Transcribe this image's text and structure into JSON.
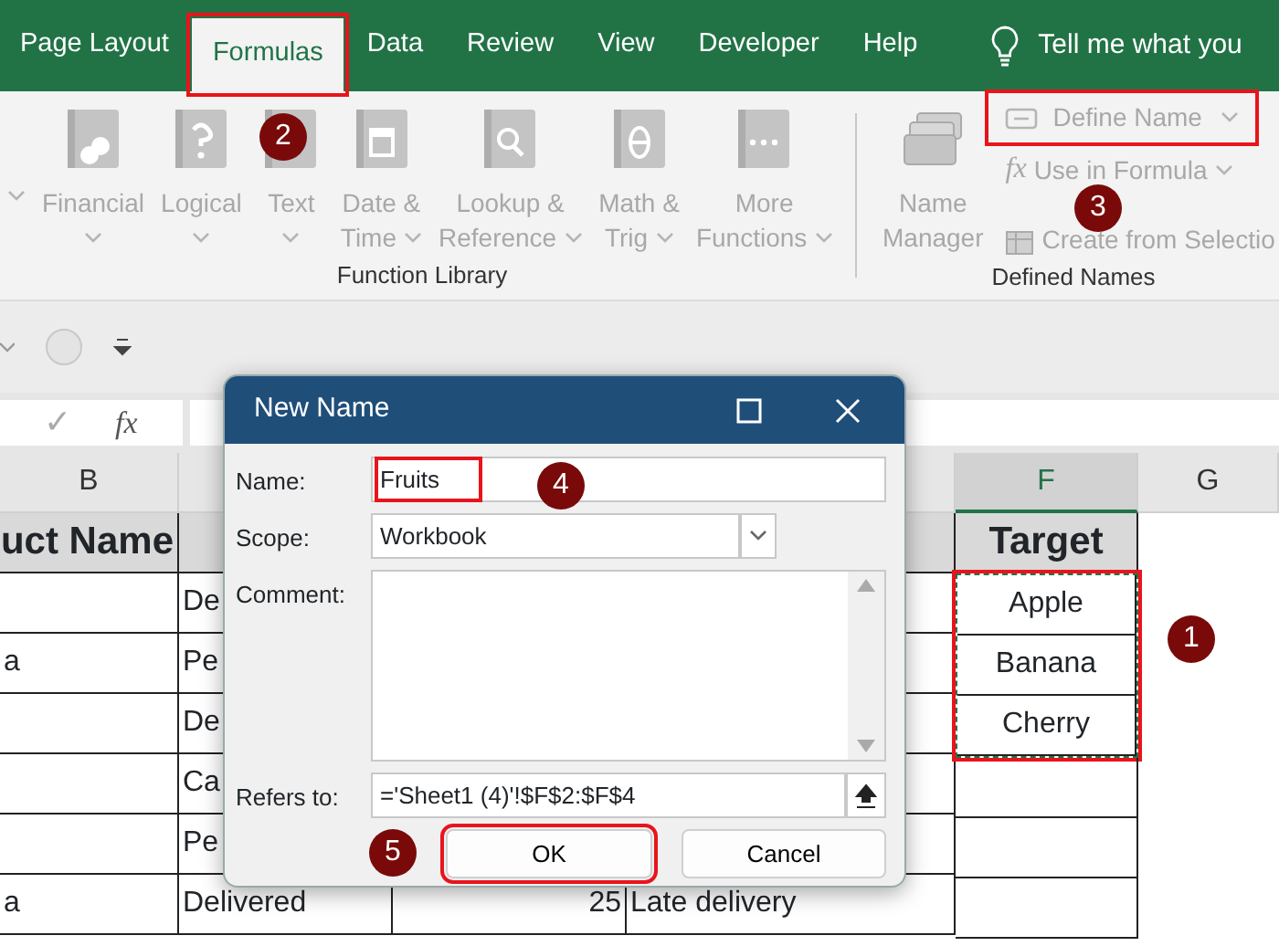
{
  "tabs": [
    {
      "label": "Page Layout",
      "selected": false,
      "highlighted": false
    },
    {
      "label": "Formulas",
      "selected": true,
      "highlighted": true
    },
    {
      "label": "Data",
      "selected": false,
      "highlighted": false
    },
    {
      "label": "Review",
      "selected": false,
      "highlighted": false
    },
    {
      "label": "View",
      "selected": false,
      "highlighted": false
    },
    {
      "label": "Developer",
      "selected": false,
      "highlighted": false
    },
    {
      "label": "Help",
      "selected": false,
      "highlighted": false
    }
  ],
  "tell_me": "Tell me what you",
  "ribbon": {
    "disabled": true,
    "function_library": {
      "label": "Function Library",
      "buttons": [
        {
          "lines": [
            "Financial"
          ],
          "dropdown": true
        },
        {
          "lines": [
            "Logical"
          ],
          "dropdown": true
        },
        {
          "lines": [
            "Text"
          ],
          "dropdown": true
        },
        {
          "lines": [
            "Date &",
            "Time"
          ],
          "dropdown": true
        },
        {
          "lines": [
            "Lookup &",
            "Reference"
          ],
          "dropdown": true
        },
        {
          "lines": [
            "Math &",
            "Trig"
          ],
          "dropdown": true
        },
        {
          "lines": [
            "More",
            "Functions"
          ],
          "dropdown": true
        }
      ]
    },
    "defined_names": {
      "label": "Defined Names",
      "name_manager": [
        "Name",
        "Manager"
      ],
      "define_name": {
        "label": "Define Name",
        "highlighted": true
      },
      "use_in_formula": {
        "symbol": "fx",
        "label": "Use in Formula"
      },
      "create_from_selection": "Create from Selectio"
    }
  },
  "formula_bar": {
    "check": "✓",
    "fx": "fx"
  },
  "sheet": {
    "columns": [
      {
        "header": "B",
        "cells": [
          "uct Name",
          "",
          "a",
          "",
          "",
          "",
          "a"
        ]
      },
      {
        "cells": [
          "",
          "De",
          "Pe",
          "De",
          "Ca",
          "Pe",
          "Delivered"
        ]
      },
      {
        "cells": [
          "",
          "",
          "",
          "",
          "",
          "",
          "25"
        ]
      },
      {
        "cells": [
          "",
          "",
          "",
          "",
          "",
          "",
          "Late delivery"
        ]
      },
      {
        "header": "F",
        "cells": [
          "Target",
          "Apple",
          "Banana",
          "Cherry",
          "",
          "",
          ""
        ],
        "selected": true,
        "highlighted": true
      },
      {
        "header": "G"
      }
    ]
  },
  "dialog": {
    "title": "New Name",
    "name": {
      "label": "Name:",
      "value": "Fruits",
      "highlighted": true
    },
    "scope": {
      "label": "Scope:",
      "value": "Workbook"
    },
    "comment": {
      "label": "Comment:"
    },
    "refers_to": {
      "label": "Refers to:",
      "value": "='Sheet1 (4)'!$F$2:$F$4"
    },
    "ok": {
      "label": "OK",
      "highlighted": true
    },
    "cancel": {
      "label": "Cancel"
    }
  },
  "callouts": [
    "1",
    "2",
    "3",
    "4",
    "5"
  ]
}
